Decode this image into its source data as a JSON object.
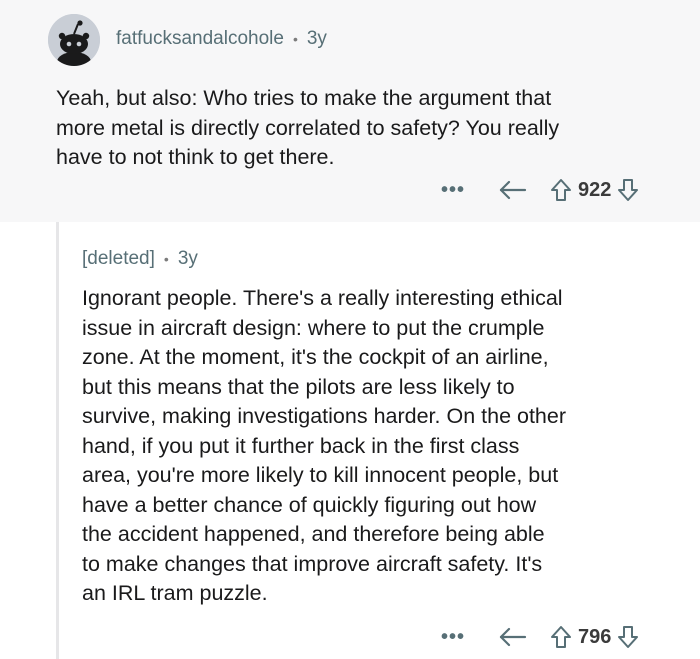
{
  "comments": [
    {
      "username": "fatfucksandalcohole",
      "age": "3y",
      "body_lines": [
        "Yeah, but also: Who tries to make the argument that",
        "more metal is directly correlated to safety? You really",
        "have to not think to get there."
      ],
      "votes": "922"
    },
    {
      "username": "[deleted]",
      "age": "3y",
      "body_lines": [
        "Ignorant people. There's a really interesting ethical",
        "issue in aircraft design: where to put the crumple",
        "zone. At the moment, it's the cockpit of an airline,",
        "but this means that the pilots are less likely to",
        "survive, making investigations harder. On the other",
        "hand, if you put it further back in the first class",
        "area, you're more likely to kill innocent people, but",
        "have a better chance of quickly figuring out how",
        "the accident happened, and therefore being able",
        "to make changes that improve aircraft safety. It's",
        "an IRL tram puzzle."
      ],
      "votes": "796"
    }
  ],
  "meta_separator": "•",
  "more_label": "•••"
}
